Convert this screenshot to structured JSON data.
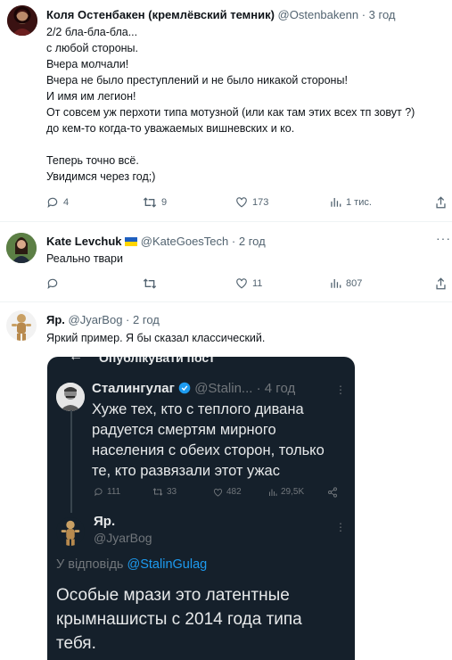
{
  "tweets": [
    {
      "name": "Коля Остенбакен (кремлёвский темник)",
      "handle": "@Ostenbakenn",
      "sep": "·",
      "time": "3 год",
      "text": "2/2 бла-бла-бла...\nс любой стороны.\nВчера молчали!\nВчера не было преступлений и не было никакой стороны!\nИ имя им легион!\nОт совсем уж перхоти типа мотузной (или как там этих всех тп зовут ?)\nдо кем-то когда-то уважаемых вишневских и ко.\n\nТеперь точно всё.\nУвидимся через год;)",
      "replies": "4",
      "retweets": "9",
      "likes": "173",
      "views": "1 тис."
    },
    {
      "name": "Kate Levchuk",
      "flag": "🇺🇦",
      "handle": "@KateGoesTech",
      "sep": "·",
      "time": "2 год",
      "text": "Реально твари",
      "replies": "",
      "retweets": "",
      "likes": "11",
      "views": "807"
    },
    {
      "name": "Яр.",
      "handle": "@JyarBog",
      "sep": "·",
      "time": "2 год",
      "text": "Яркий пример. Я бы сказал классический."
    }
  ],
  "embedded_screenshot": {
    "header_title": "Опублікувати пост",
    "quoted": {
      "name": "Сталингулаг",
      "handle": "@Stalin...",
      "time": "· 4 год",
      "text": "Хуже тех, кто с теплого дивана\nрадуется смертям мирного\nнаселения с обеих сторон, только\nте, кто развязали этот ужас",
      "replies": "111",
      "retweets": "33",
      "likes": "482",
      "views": "29,5K"
    },
    "reply_author_name": "Яр.",
    "reply_author_handle": "@JyarBog",
    "reply_to_prefix": "У відповідь",
    "reply_to_link": "@StalinGulag",
    "reply_text": "Особые мрази это латентные\nкрымнашисты с 2014 года типа\nтебя."
  },
  "colors": {
    "muted": "#536471",
    "divider": "#eff3f4",
    "verified": "#1d9bf0",
    "dark_bg": "#15202b"
  }
}
